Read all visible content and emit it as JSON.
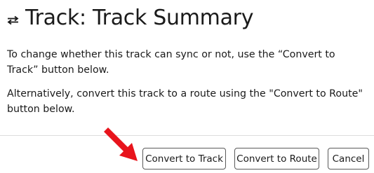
{
  "header": {
    "icon": "swap-arrows-icon",
    "title": "Track: Track Summary"
  },
  "body": {
    "paragraph1": "To change whether this track can sync or not, use the “Convert to Track” button below.",
    "paragraph2": "Alternatively, convert this track to a route using the \"Convert to Route\" button below."
  },
  "footer": {
    "convert_track_label": "Convert to Track",
    "convert_route_label": "Convert to Route",
    "cancel_label": "Cancel"
  },
  "annotation": {
    "icon": "red-arrow-icon",
    "color": "#e8141c"
  }
}
